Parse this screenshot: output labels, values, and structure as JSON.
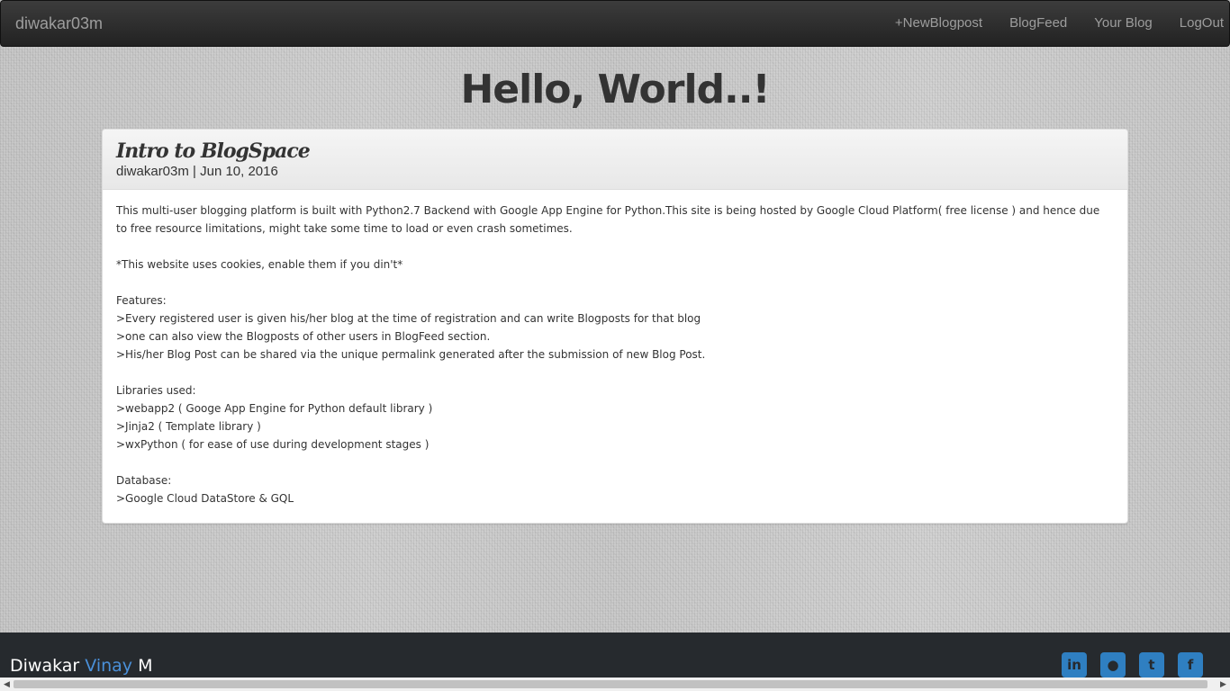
{
  "navbar": {
    "brand": "diwakar03m",
    "links": [
      "+NewBlogpost",
      "BlogFeed",
      "Your Blog",
      "LogOut"
    ]
  },
  "hero": {
    "title": "Hello, World..!"
  },
  "post": {
    "title": "Intro to BlogSpace",
    "meta": "diwakar03m | Jun 10, 2016",
    "lines": [
      "This multi-user blogging platform is built with Python2.7 Backend with Google App Engine for Python.This site is being hosted by Google Cloud Platform( free license ) and hence due to free resource limitations, might take some time to load or even crash sometimes.",
      "",
      "*This website uses cookies, enable them if you din't*",
      "",
      "Features:",
      ">Every registered user is given his/her blog at the time of registration and can write Blogposts for that blog",
      ">one can also view the Blogposts of other users in BlogFeed section.",
      ">His/her Blog Post can be shared via the unique permalink generated after the submission of new Blog Post.",
      "",
      "Libraries used:",
      ">webapp2 ( Googe App Engine for Python default library )",
      ">Jinja2 ( Template library )",
      ">wxPython ( for ease of use during development stages )",
      "",
      "Database:",
      ">Google Cloud DataStore & GQL"
    ]
  },
  "footer": {
    "name_first": "Diwakar",
    "name_middle": "Vinay",
    "name_last": "M",
    "socials": [
      {
        "icon": "linkedin-icon",
        "glyph": "in"
      },
      {
        "icon": "github-icon",
        "glyph": "●"
      },
      {
        "icon": "twitter-icon",
        "glyph": "t"
      },
      {
        "icon": "facebook-icon",
        "glyph": "f"
      }
    ]
  },
  "colors": {
    "accent": "#4a90d9",
    "social": "#2f7fc1",
    "footer_bg": "#262a2e",
    "navbar_bg": "#222222"
  }
}
